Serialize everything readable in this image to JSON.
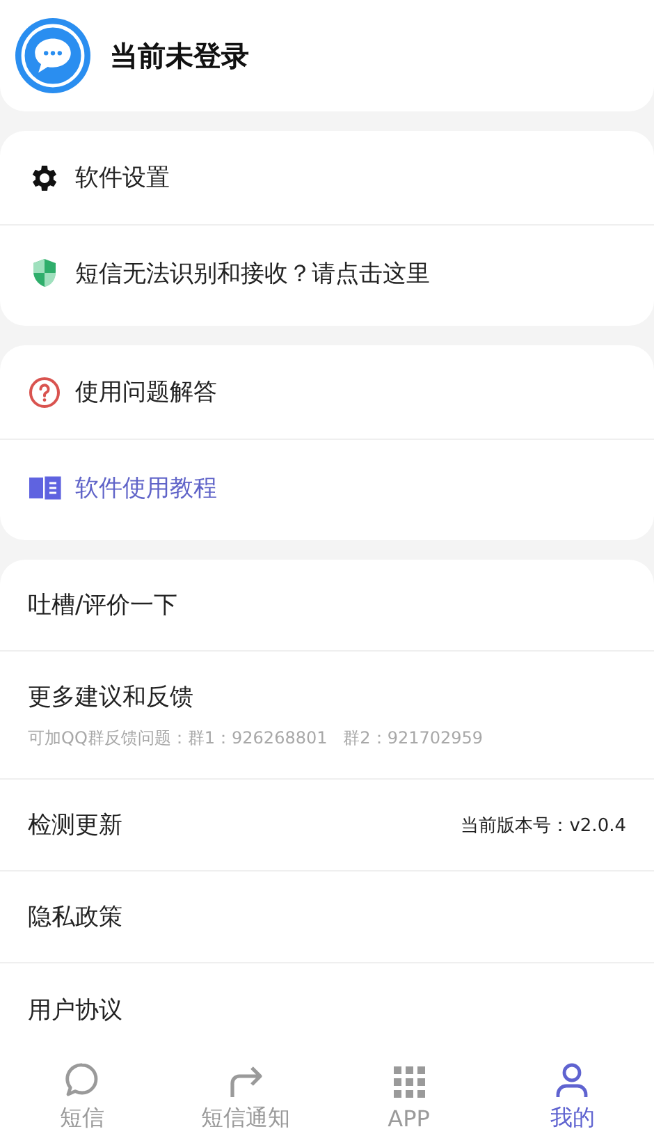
{
  "header": {
    "title": "当前未登录"
  },
  "section_1": [
    {
      "label": "软件设置",
      "highlighted": false
    },
    {
      "label": "短信无法识别和接收？请点击这里",
      "highlighted": false
    }
  ],
  "section_2": [
    {
      "label": "使用问题解答",
      "highlighted": false
    },
    {
      "label": "软件使用教程",
      "highlighted": true
    }
  ],
  "section_3": [
    {
      "label": "吐槽/评价一下"
    },
    {
      "label": "更多建议和反馈",
      "subtitle": "可加QQ群反馈问题：群1：926268801   群2：921702959"
    },
    {
      "label": "检测更新",
      "value": "当前版本号：v2.0.4"
    },
    {
      "label": "隐私政策"
    },
    {
      "label": "用户协议"
    }
  ],
  "bottom_nav": [
    {
      "label": "短信",
      "selected": false
    },
    {
      "label": "短信通知",
      "selected": false
    },
    {
      "label": "APP",
      "selected": false
    },
    {
      "label": "我的",
      "selected": true
    }
  ]
}
